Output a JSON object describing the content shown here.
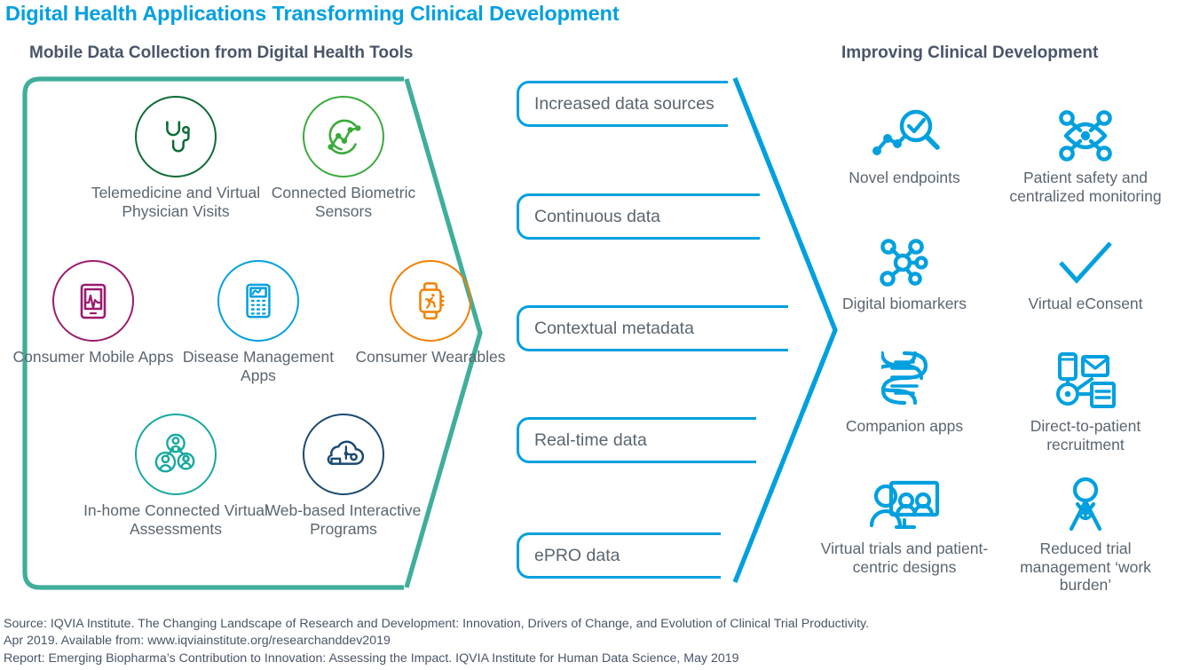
{
  "title": "Digital Health Applications Transforming Clinical Development",
  "colors": {
    "title_blue": "#00a0df",
    "accent_blue": "#00a0df",
    "bracket_green": "#3fae9a",
    "text_gray": "#5b6670",
    "heading_gray": "#4a5568"
  },
  "left_panel": {
    "title": "Mobile Data Collection from Digital Health Tools",
    "items": [
      {
        "label": "Telemedicine and Virtual Physician Visits",
        "icon": "stethoscope-icon",
        "color": "#0b6b36"
      },
      {
        "label": "Connected Biometric Sensors",
        "icon": "biometric-trend-icon",
        "color": "#3aab3a"
      },
      {
        "label": "Consumer Mobile Apps",
        "icon": "mobile-vitals-icon",
        "color": "#9b1b6e"
      },
      {
        "label": "Disease Management Apps",
        "icon": "calculator-icon",
        "color": "#00a0df"
      },
      {
        "label": "Consumer Wearables",
        "icon": "smartwatch-runner-icon",
        "color": "#f08000"
      },
      {
        "label": "In-home Connected Virtual Assessments",
        "icon": "connected-people-icon",
        "color": "#17a9a0"
      },
      {
        "label": "Web-based Interactive Programs",
        "icon": "cloud-network-icon",
        "color": "#1b4a72"
      }
    ]
  },
  "funnel": {
    "items": [
      {
        "label": "Increased data sources"
      },
      {
        "label": "Continuous data"
      },
      {
        "label": "Contextual metadata"
      },
      {
        "label": "Real-time data"
      },
      {
        "label": "ePRO data"
      }
    ]
  },
  "right_panel": {
    "title": "Improving Clinical Development",
    "items": [
      {
        "label": "Novel endpoints",
        "icon": "endpoint-magnifier-icon"
      },
      {
        "label": "Patient safety and centralized monitoring",
        "icon": "eye-network-icon"
      },
      {
        "label": "Digital biomarkers",
        "icon": "molecule-node-icon"
      },
      {
        "label": "Virtual eConsent",
        "icon": "checkmark-icon"
      },
      {
        "label": "Companion apps",
        "icon": "dna-helix-icon"
      },
      {
        "label": "Direct-to-patient recruitment",
        "icon": "phone-mail-document-icon"
      },
      {
        "label": "Virtual trials and patient-centric designs",
        "icon": "virtual-meeting-icon"
      },
      {
        "label": "Reduced trial management ‘work burden’",
        "icon": "clinician-icon"
      }
    ]
  },
  "footer": {
    "line1": "Source: IQVIA Institute. The Changing Landscape of Research and Development: Innovation, Drivers of Change, and Evolution of Clinical Trial Productivity.",
    "line2": "Apr 2019. Available from: www.iqviainstitute.org/researchanddev2019",
    "line3": "Report: Emerging Biopharma’s Contribution to Innovation: Assessing the Impact. IQVIA Institute for Human Data Science, May 2019"
  }
}
